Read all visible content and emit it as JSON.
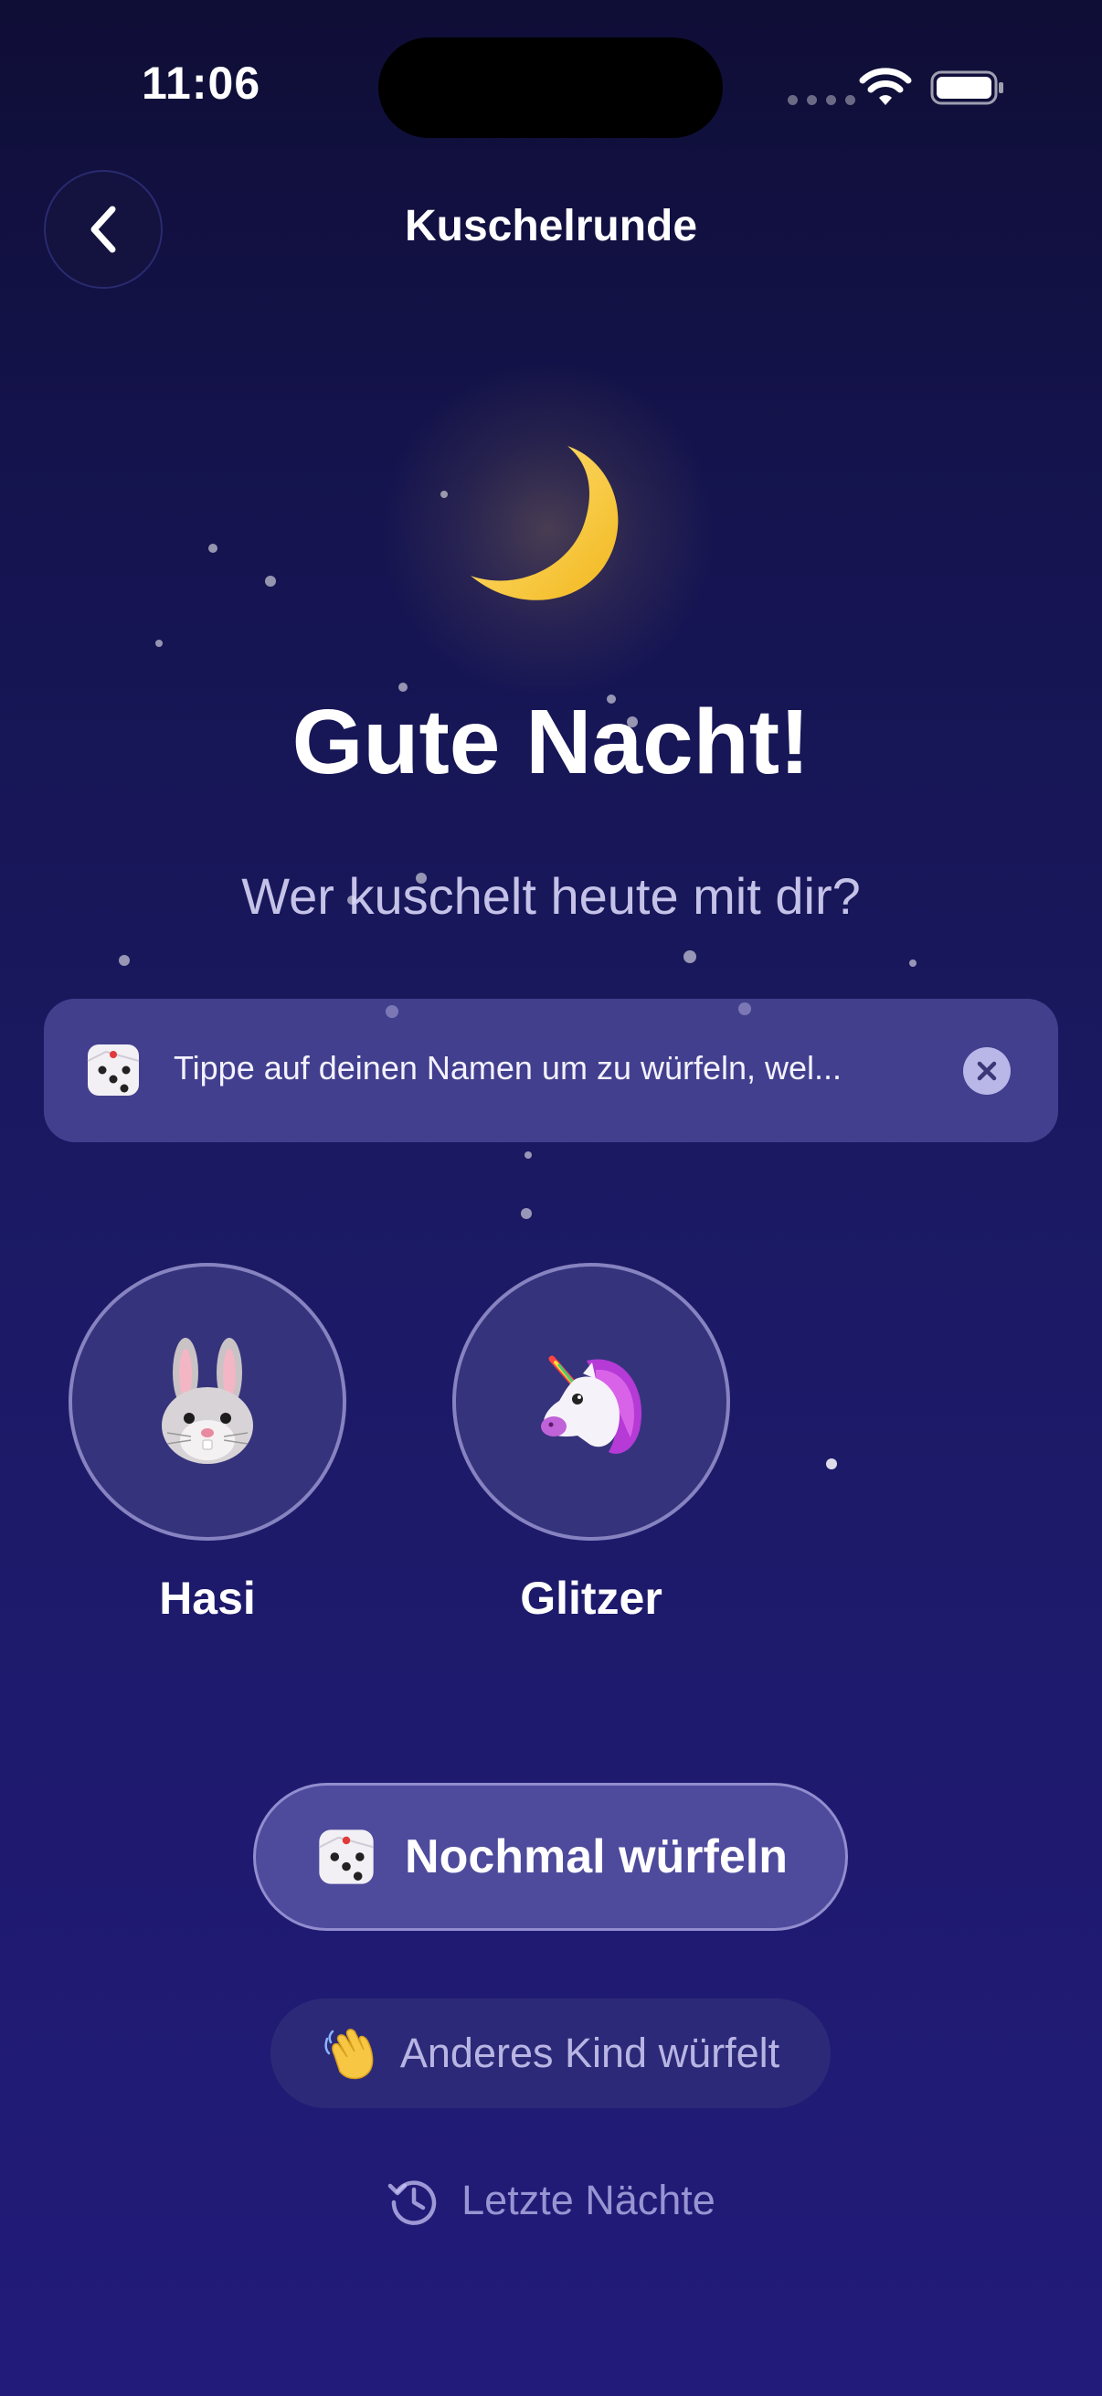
{
  "status_bar": {
    "time": "11:06"
  },
  "header": {
    "title": "Kuschelrunde",
    "back_icon": "chevron-left-icon"
  },
  "main": {
    "moon_icon": "crescent-moon-icon",
    "headline": "Gute Nacht!",
    "subline": "Wer kuschelt heute mit dir?"
  },
  "hint": {
    "icon": "dice-icon",
    "text": "Tippe auf deinen Namen um zu würfeln, wel...",
    "close_icon": "close-icon"
  },
  "kids": [
    {
      "name": "Hasi",
      "avatar": "rabbit-icon"
    },
    {
      "name": "Glitzer",
      "avatar": "unicorn-icon"
    }
  ],
  "actions": {
    "reroll_label": "Nochmal würfeln",
    "reroll_icon": "dice-icon",
    "other_child_label": "Anderes Kind würfelt",
    "other_child_icon": "waving-hand-icon",
    "history_label": "Letzte Nächte",
    "history_icon": "history-icon"
  },
  "colors": {
    "background_top": "#0f0e36",
    "background_bottom": "#221b7a",
    "moon": "#ffd24a",
    "primary_button": "#4e4a9c"
  }
}
